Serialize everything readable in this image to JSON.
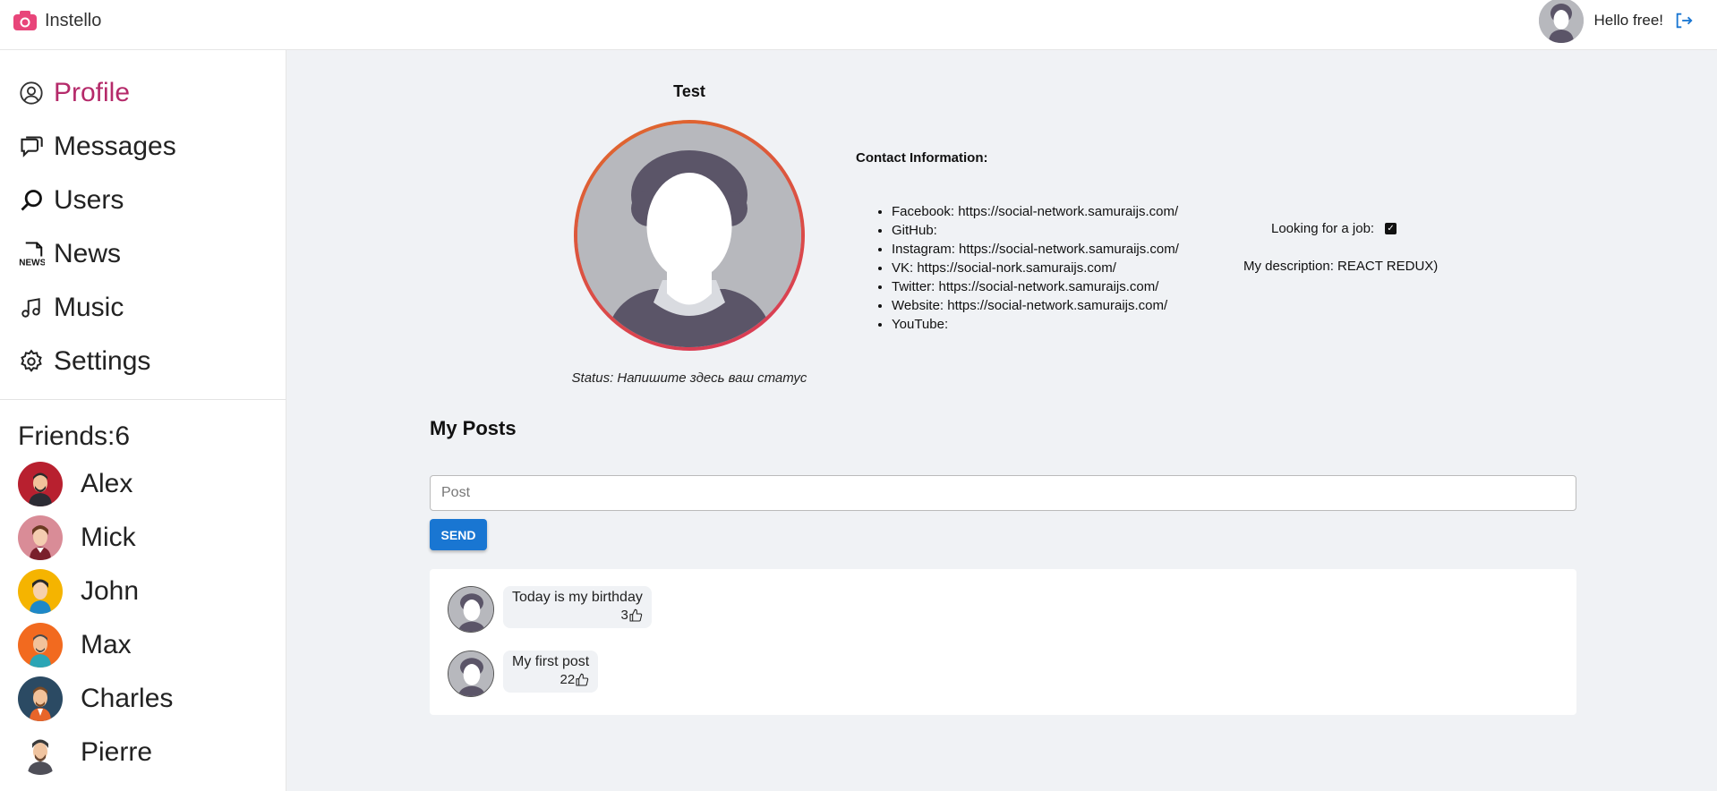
{
  "app": {
    "title": "Instello"
  },
  "header": {
    "greeting": "Hello free!"
  },
  "sidebar": {
    "items": [
      {
        "label": "Profile",
        "icon": "user-circle-icon",
        "active": true
      },
      {
        "label": "Messages",
        "icon": "chat-icon",
        "active": false
      },
      {
        "label": "Users",
        "icon": "search-icon",
        "active": false
      },
      {
        "label": "News",
        "icon": "news-icon",
        "active": false
      },
      {
        "label": "Music",
        "icon": "music-note-icon",
        "active": false
      },
      {
        "label": "Settings",
        "icon": "gear-icon",
        "active": false
      }
    ],
    "friends_title": "Friends:6",
    "friends": [
      {
        "name": "Alex",
        "color": "#b8202f"
      },
      {
        "name": "Mick",
        "color": "#d98c97"
      },
      {
        "name": "John",
        "color": "#f5b400"
      },
      {
        "name": "Max",
        "color": "#f26a1f"
      },
      {
        "name": "Charles",
        "color": "#2b4a63"
      },
      {
        "name": "Pierre",
        "color": "#ffffff"
      }
    ]
  },
  "profile": {
    "name": "Test",
    "status": "Status: Напишите здесь ваш статус",
    "contacts_title": "Contact Information:",
    "contacts": [
      "Facebook: https://social-network.samuraijs.com/",
      "GitHub:",
      "Instagram: https://social-network.samuraijs.com/",
      "VK: https://social-nork.samuraijs.com/",
      "Twitter: https://social-network.samuraijs.com/",
      "Website: https://social-network.samuraijs.com/",
      "YouTube:"
    ],
    "job_label": "Looking for a job:",
    "job_checked": true,
    "description": "My description: REACT REDUX)"
  },
  "posts": {
    "title": "My Posts",
    "input_placeholder": "Post",
    "send_label": "SEND",
    "items": [
      {
        "text": "Today is my birthday",
        "likes": "3"
      },
      {
        "text": "My first post",
        "likes": "22"
      }
    ]
  },
  "colors": {
    "accent": "#b52a6a",
    "button": "#1976d2",
    "background": "#f0f2f5"
  }
}
